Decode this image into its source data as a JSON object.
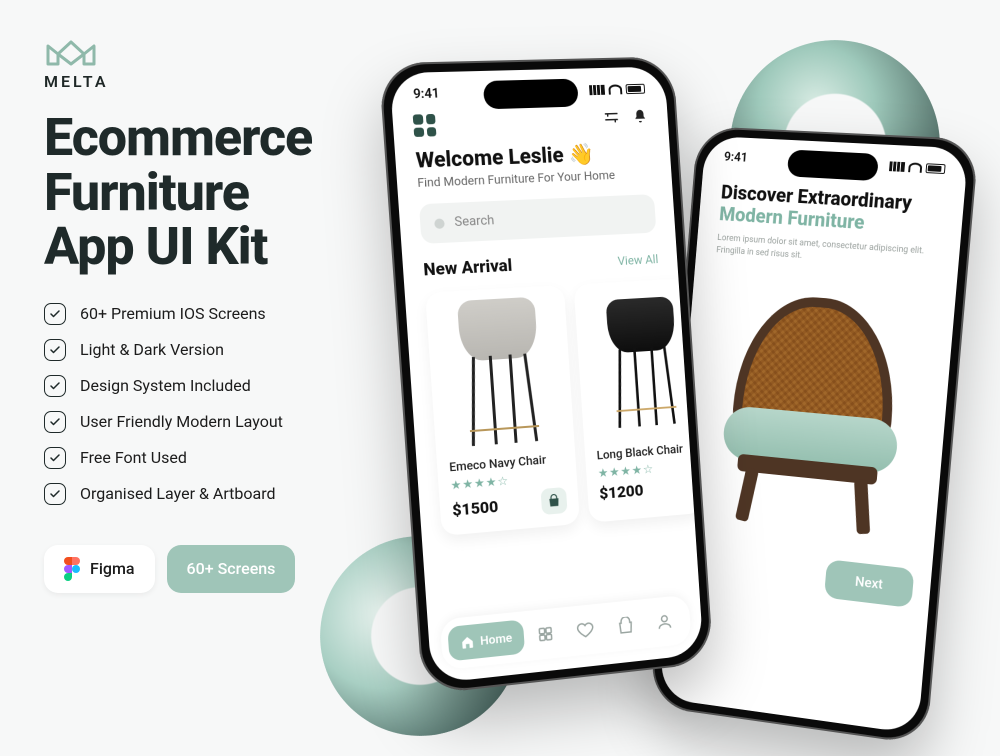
{
  "brand": {
    "name": "MELTA"
  },
  "headline": "Ecommerce\nFurniture\nApp UI Kit",
  "features": [
    "60+ Premium IOS Screens",
    "Light & Dark Version",
    "Design System Included",
    "User Friendly Modern Layout",
    "Free Font Used",
    "Organised Layer & Artboard"
  ],
  "badges": {
    "figma": "Figma",
    "screens": "60+ Screens"
  },
  "phone1": {
    "status_time": "9:41",
    "welcome_title": "Welcome Leslie 👋",
    "welcome_sub": "Find Modern Furniture For Your Home",
    "search_placeholder": "Search",
    "section_title": "New Arrival",
    "view_all": "View All",
    "nav_home": "Home",
    "products": [
      {
        "name": "Emeco Navy Chair",
        "price": "$1500",
        "stars": "★★★★☆"
      },
      {
        "name": "Long Black Chair",
        "price": "$1200",
        "stars": "★★★★☆"
      }
    ]
  },
  "phone2": {
    "status_time": "9:41",
    "title_line1": "Discover Extraordinary",
    "title_line2": "Modern Furniture",
    "desc": "Lorem ipsum dolor sit amet, consectetur adipiscing elit. Fringilla in sed risus sit.",
    "next": "Next"
  }
}
